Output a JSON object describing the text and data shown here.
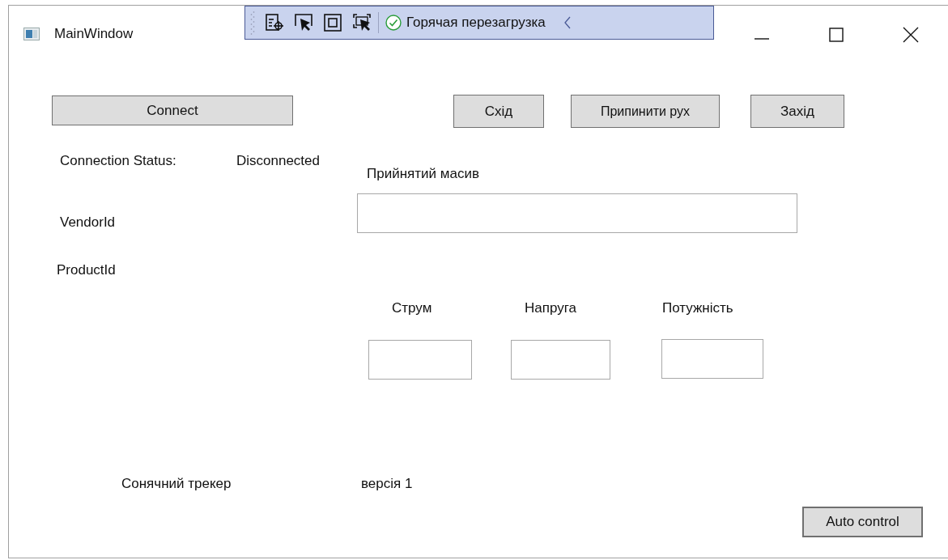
{
  "window": {
    "title": "MainWindow"
  },
  "debug_toolbar": {
    "hot_reload": "Горячая перезагрузка"
  },
  "connect_button": "Connect",
  "motion_buttons": [
    "Схід",
    "Припинити рух",
    "Захід"
  ],
  "connection_status": {
    "label": "Connection Status:",
    "value": "Disconnected"
  },
  "received_array": {
    "label": "Прийнятий масив"
  },
  "vendor_id": "VendorId",
  "product_id": "ProductId",
  "readings": [
    {
      "label": "Струм"
    },
    {
      "label": "Напруга"
    },
    {
      "label": "Потужність"
    }
  ],
  "footer": {
    "name": "Сонячний трекер",
    "version": "версія 1"
  },
  "auto_control_button": "Auto control"
}
